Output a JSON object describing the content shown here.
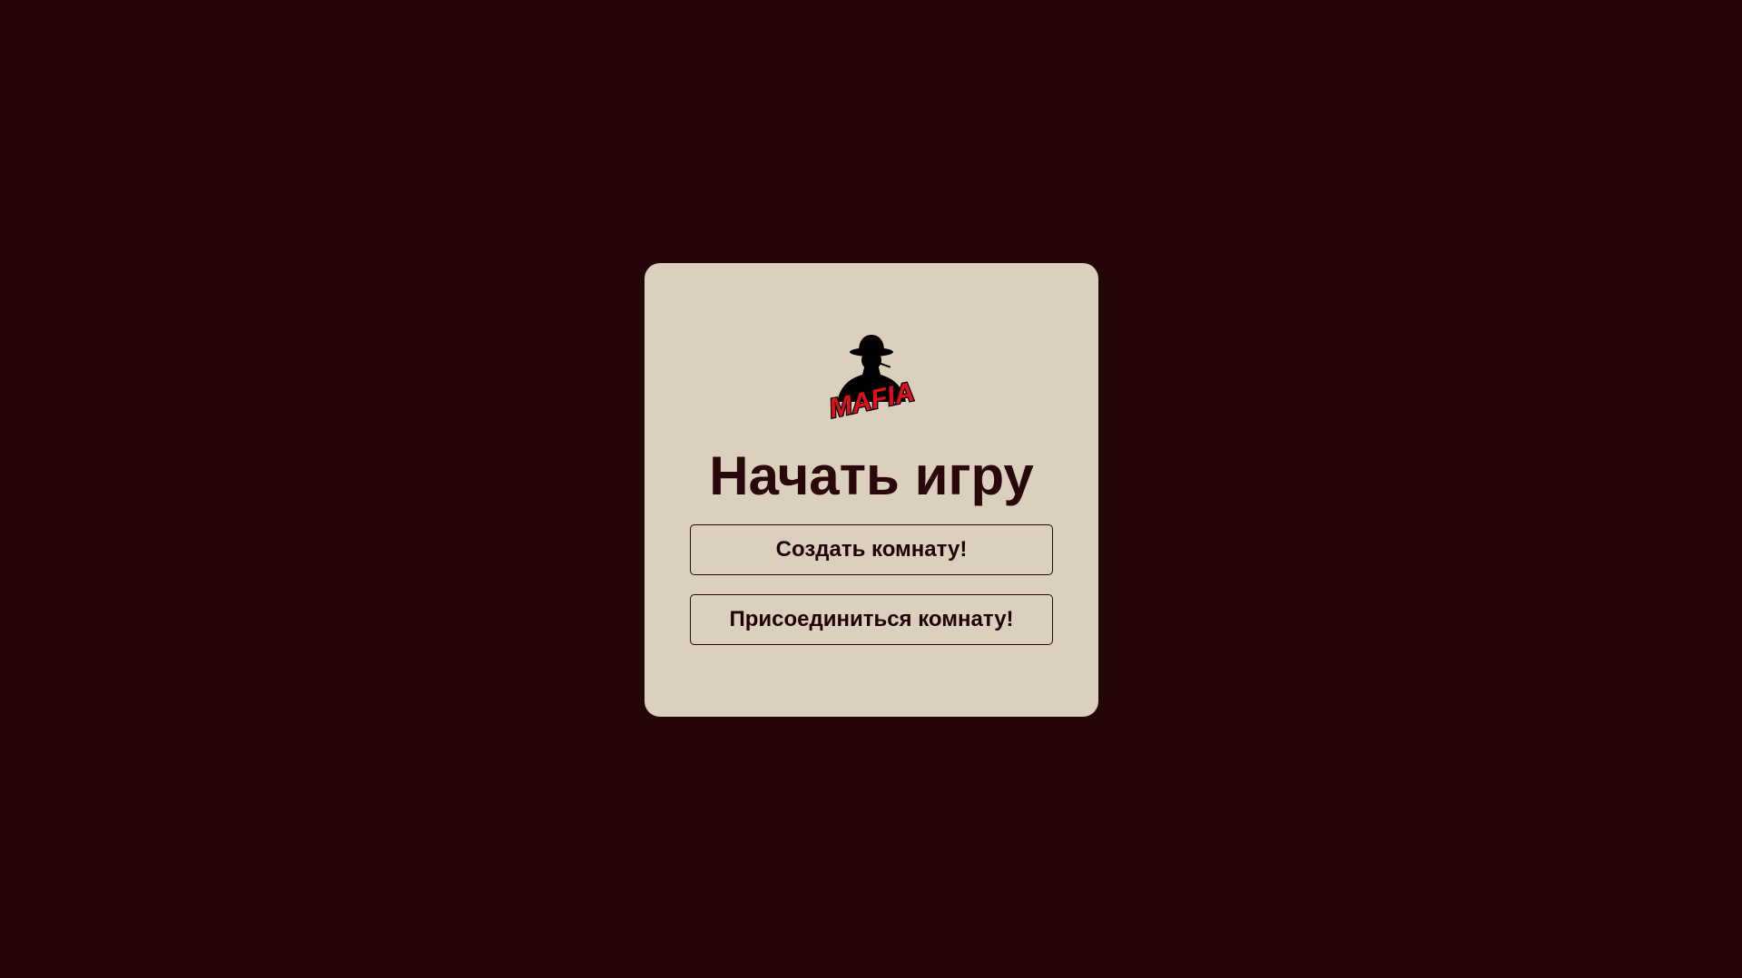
{
  "colors": {
    "background": "#240508",
    "card": "#dbcfbe",
    "title_text": "#2a070b",
    "button_border": "#2a070b",
    "logo_red": "#e0101a"
  },
  "logo": {
    "icon": "mafia-silhouette-logo",
    "text": "MAFIA"
  },
  "page": {
    "title": "Начать игру"
  },
  "buttons": {
    "create_label": "Создать комнату!",
    "join_label": "Присоединиться комнату!"
  }
}
